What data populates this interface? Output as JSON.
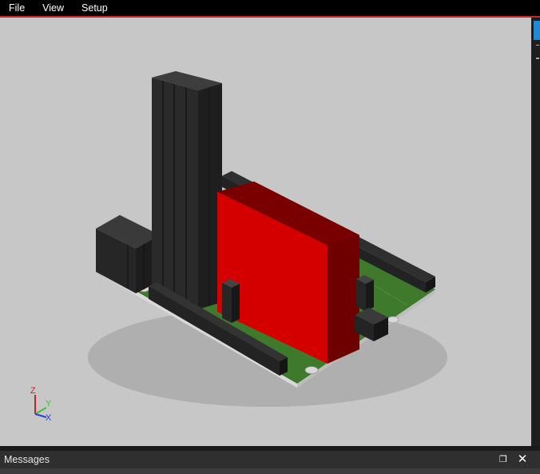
{
  "menu": {
    "items": [
      "File",
      "View",
      "Setup"
    ]
  },
  "viewport": {
    "axes": {
      "z": "Z",
      "y": "Y",
      "x": "X"
    }
  },
  "messages": {
    "title": "Messages",
    "float_icon": "restore-window-icon",
    "close_icon": "close-icon"
  },
  "colors": {
    "accent_bar": "#c62828",
    "viewport_bg": "#c7c7c7",
    "pcb": "#3f7a2c",
    "component_red": "#d40000",
    "connector": "#2f2f2f"
  }
}
